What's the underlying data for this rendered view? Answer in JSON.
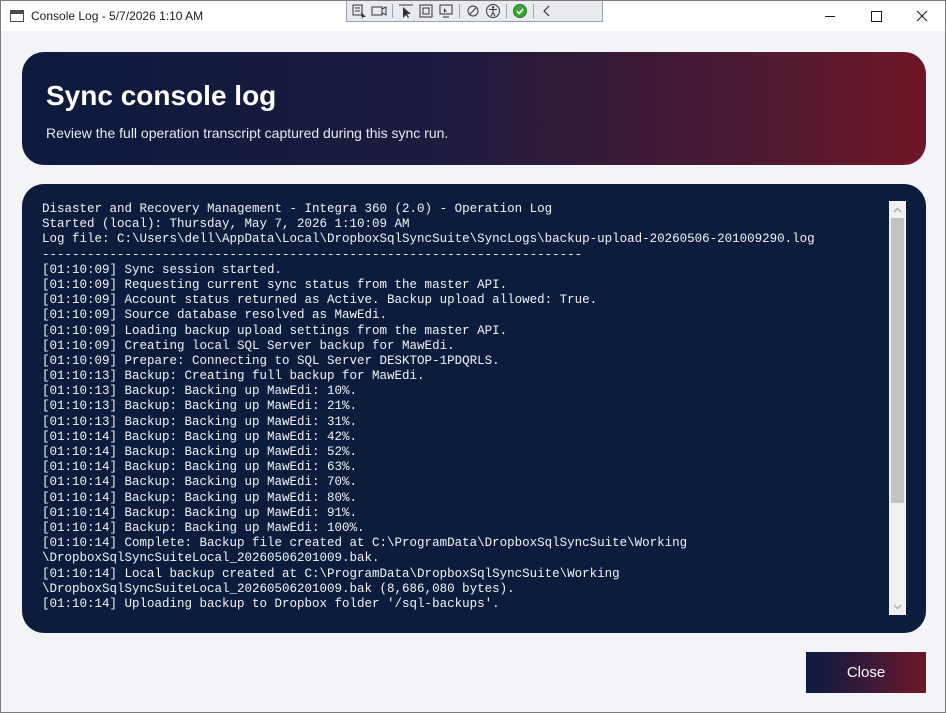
{
  "window": {
    "title": "Console Log - 5/7/2026 1:10 AM",
    "icon": "console-window-icon",
    "controls": [
      "minimize-icon",
      "maximize-icon",
      "close-icon"
    ]
  },
  "devtools": {
    "icons": [
      "select-element-icon",
      "live-visual-tree-icon",
      "pointer-icon",
      "track-focus-icon",
      "layout-adorner-icon",
      "binding-failures-icon",
      "accessibility-icon",
      "check-icon",
      "collapse-chevron-icon"
    ]
  },
  "header": {
    "title": "Sync console log",
    "subtitle": "Review the full operation transcript captured during this sync run."
  },
  "log": {
    "lines": [
      "Disaster and Recovery Management - Integra 360 (2.0) - Operation Log",
      "Started (local): Thursday, May 7, 2026 1:10:09 AM",
      "Log file: C:\\Users\\dell\\AppData\\Local\\DropboxSqlSyncSuite\\SyncLogs\\backup-upload-20260506-201009290.log",
      "------------------------------------------------------------------------",
      "[01:10:09] Sync session started.",
      "[01:10:09] Requesting current sync status from the master API.",
      "[01:10:09] Account status returned as Active. Backup upload allowed: True.",
      "[01:10:09] Source database resolved as MawEdi.",
      "[01:10:09] Loading backup upload settings from the master API.",
      "[01:10:09] Creating local SQL Server backup for MawEdi.",
      "[01:10:09] Prepare: Connecting to SQL Server DESKTOP-1PDQRLS.",
      "[01:10:13] Backup: Creating full backup for MawEdi.",
      "[01:10:13] Backup: Backing up MawEdi: 10%.",
      "[01:10:13] Backup: Backing up MawEdi: 21%.",
      "[01:10:13] Backup: Backing up MawEdi: 31%.",
      "[01:10:14] Backup: Backing up MawEdi: 42%.",
      "[01:10:14] Backup: Backing up MawEdi: 52%.",
      "[01:10:14] Backup: Backing up MawEdi: 63%.",
      "[01:10:14] Backup: Backing up MawEdi: 70%.",
      "[01:10:14] Backup: Backing up MawEdi: 80%.",
      "[01:10:14] Backup: Backing up MawEdi: 91%.",
      "[01:10:14] Backup: Backing up MawEdi: 100%.",
      "[01:10:14] Complete: Backup file created at C:\\ProgramData\\DropboxSqlSyncSuite\\Working",
      "\\DropboxSqlSyncSuiteLocal_20260506201009.bak.",
      "[01:10:14] Local backup created at C:\\ProgramData\\DropboxSqlSyncSuite\\Working",
      "\\DropboxSqlSyncSuiteLocal_20260506201009.bak (8,686,080 bytes).",
      "[01:10:14] Uploading backup to Dropbox folder '/sql-backups'."
    ]
  },
  "footer": {
    "close_label": "Close"
  },
  "colors": {
    "gradient_start": "#0c1a3e",
    "gradient_end": "#701626",
    "log_background": "#0b1c3c",
    "log_text": "#f2f4f8",
    "window_background": "#f3f4f8"
  }
}
